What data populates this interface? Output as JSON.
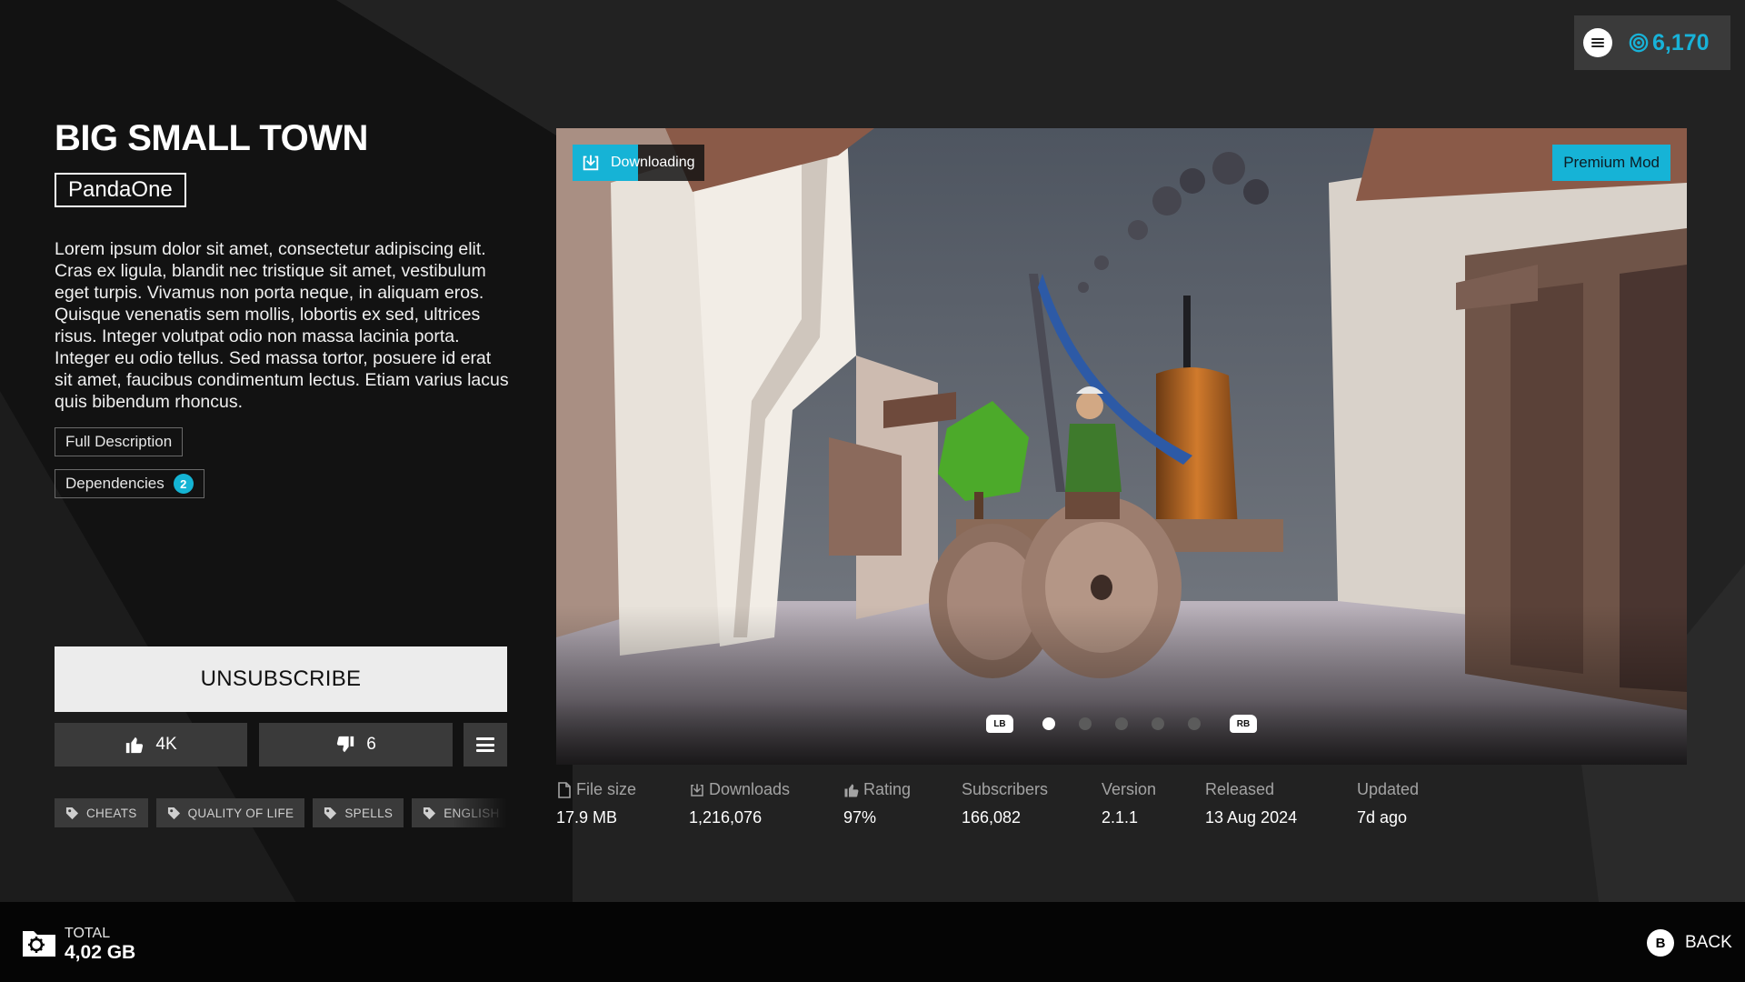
{
  "mod": {
    "title": "BIG SMALL TOWN",
    "author": "PandaOne",
    "description": "Lorem ipsum dolor sit amet, consectetur adipiscing elit. Cras ex ligula, blandit nec tristique sit amet, vestibulum eget turpis. Vivamus non porta neque, in aliquam eros. Quisque venenatis sem mollis, lobortis ex sed, ultrices risus. Integer volutpat odio non massa lacinia porta. Integer eu odio tellus. Sed massa tortor, posuere id erat sit amet, faucibus condimentum lectus. Etiam varius lacus quis bibendum rhoncus."
  },
  "actions": {
    "full_description_label": "Full Description",
    "dependencies_label": "Dependencies",
    "dependencies_count": "2",
    "unsubscribe_label": "UNSUBSCRIBE",
    "likes": "4K",
    "dislikes": "6"
  },
  "tags": [
    {
      "label": "CHEATS",
      "icon": "tag-icon"
    },
    {
      "label": "QUALITY OF LIFE",
      "icon": "tag-icon"
    },
    {
      "label": "SPELLS",
      "icon": "tag-icon"
    },
    {
      "label": "ENGLISH",
      "icon": "tag-icon"
    }
  ],
  "media": {
    "download_status": "Downloading",
    "download_progress": 0.5,
    "badge": "Premium Mod",
    "left_bumper": "LB",
    "right_bumper": "RB",
    "slide_count": 5,
    "active_slide": 1
  },
  "stats": [
    {
      "label": "File size",
      "value": "17.9 MB",
      "icon": "file-icon"
    },
    {
      "label": "Downloads",
      "value": "1,216,076",
      "icon": "download-icon"
    },
    {
      "label": "Rating",
      "value": "97%",
      "icon": "thumbs-up-icon"
    },
    {
      "label": "Subscribers",
      "value": "166,082",
      "icon": ""
    },
    {
      "label": "Version",
      "value": "2.1.1",
      "icon": ""
    },
    {
      "label": "Released",
      "value": "13 Aug 2024",
      "icon": ""
    },
    {
      "label": "Updated",
      "value": "7d ago",
      "icon": ""
    }
  ],
  "wallet": {
    "balance": "6,170",
    "accent": "#18b2d8"
  },
  "footer": {
    "total_label": "TOTAL",
    "total_value": "4,02 GB",
    "back_key": "B",
    "back_label": "BACK"
  },
  "colors": {
    "accent": "#16b3d6",
    "button_dark": "#3a3a3a",
    "button_light": "#ececec"
  }
}
